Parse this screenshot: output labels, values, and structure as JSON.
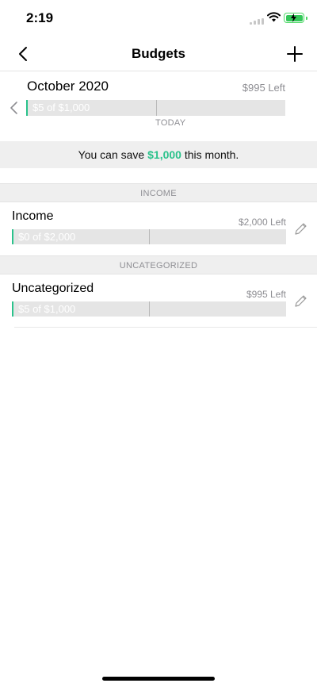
{
  "status_bar": {
    "time": "2:19",
    "battery_color": "#34c759"
  },
  "nav": {
    "back_icon": "chevron-left-icon",
    "title": "Budgets",
    "add_icon": "plus-icon"
  },
  "month": {
    "title": "October 2020",
    "left_text": "$995 Left",
    "bar_label": "$5 of $1,000",
    "spent_fraction": 0.005,
    "today_fraction": 0.5,
    "today_label": "TODAY"
  },
  "save_banner": {
    "prefix": "You can save ",
    "amount": "$1,000",
    "suffix": " this month."
  },
  "sections": [
    {
      "header": "INCOME",
      "items": [
        {
          "name": "Income",
          "left_text": "$2,000 Left",
          "bar_label": "$0 of $2,000",
          "spent_fraction": 0,
          "today_fraction": 0.5
        }
      ]
    },
    {
      "header": "UNCATEGORIZED",
      "items": [
        {
          "name": "Uncategorized",
          "left_text": "$995 Left",
          "bar_label": "$5 of $1,000",
          "spent_fraction": 0.005,
          "today_fraction": 0.5
        }
      ]
    }
  ],
  "colors": {
    "accent": "#2ac28b",
    "bar_track": "#e5e5e5",
    "banner_bg": "#efefef",
    "muted_text": "#8e8e93"
  }
}
